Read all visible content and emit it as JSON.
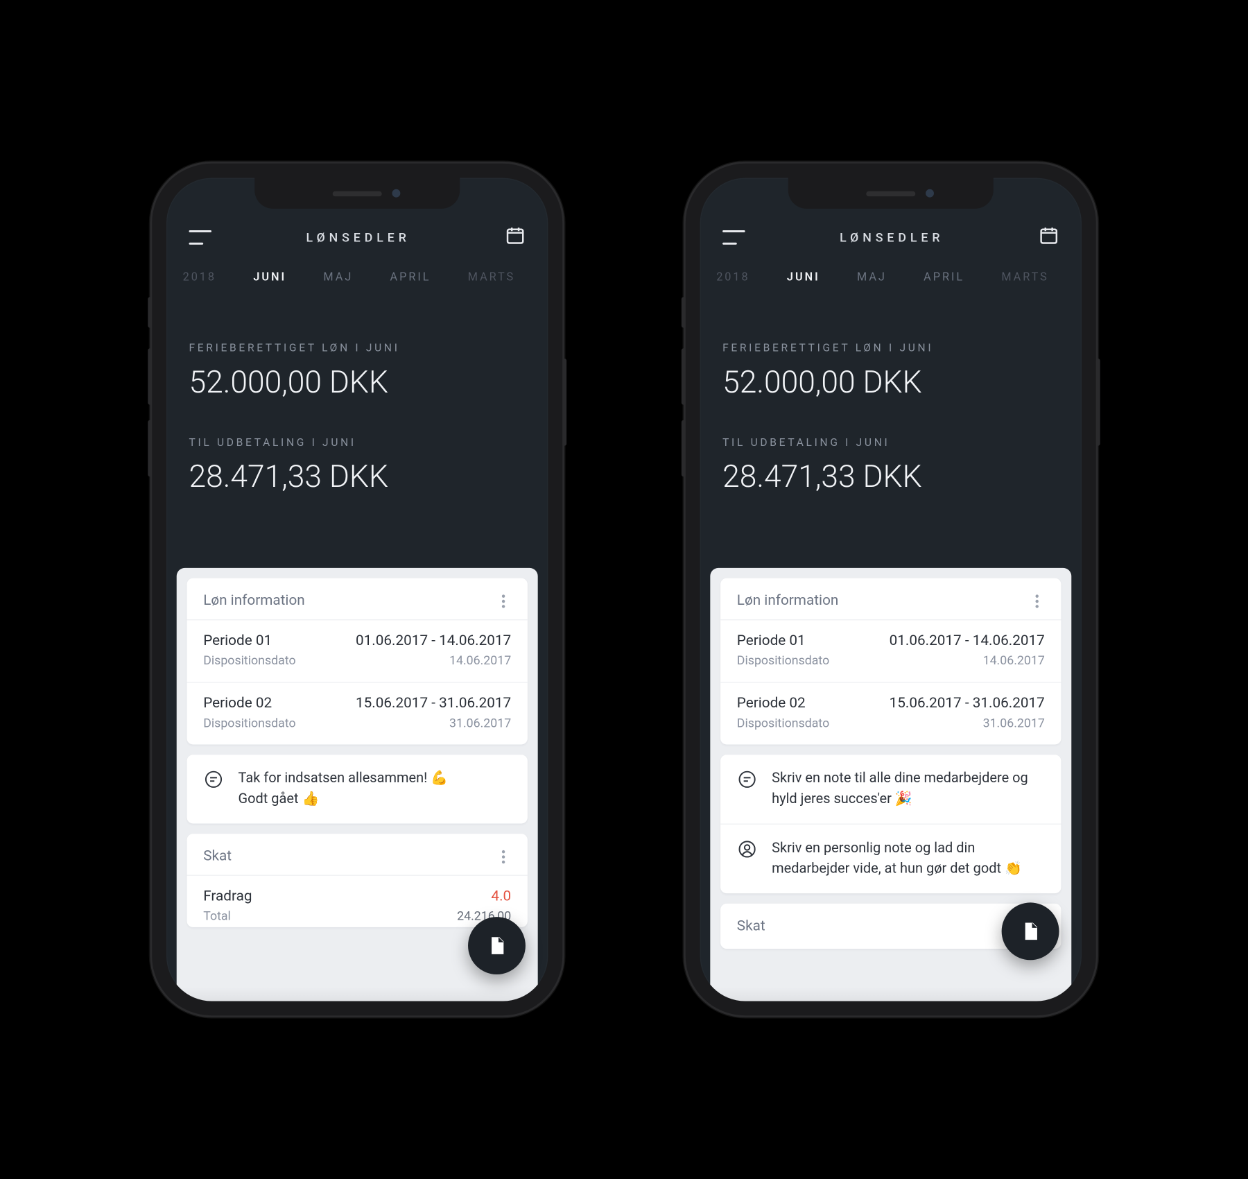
{
  "header": {
    "title": "LØNSEDLER"
  },
  "tabs": {
    "year": "2018",
    "items": [
      "JUNI",
      "MAJ",
      "APRIL",
      "MARTS"
    ],
    "active": "JUNI"
  },
  "hero": {
    "label1": "FERIEBERETTIGET LØN I JUNI",
    "value1": "52.000,00 DKK",
    "label2": "TIL UDBETALING I JUNI",
    "value2": "28.471,33 DKK"
  },
  "info_card": {
    "title": "Løn information",
    "periods": [
      {
        "name": "Periode 01",
        "range": "01.06.2017 - 14.06.2017",
        "dispo_label": "Dispositionsdato",
        "dispo_date": "14.06.2017"
      },
      {
        "name": "Periode 02",
        "range": "15.06.2017 - 31.06.2017",
        "dispo_label": "Dispositionsdato",
        "dispo_date": "31.06.2017"
      }
    ]
  },
  "notes_left": [
    {
      "icon": "chat-icon",
      "text": "Tak for indsatsen allesammen! 💪\nGodt gået 👍"
    }
  ],
  "notes_right": [
    {
      "icon": "chat-icon",
      "text": "Skriv en note til alle dine medarbejdere og hyld jeres succes'er 🎉"
    },
    {
      "icon": "person-icon",
      "text": "Skriv en personlig note og lad din medarbejder vide, at hun gør det godt 👏"
    }
  ],
  "skat": {
    "title": "Skat",
    "fradrag_label": "Fradrag",
    "fradrag_value": "4.0",
    "total_label": "Total",
    "total_value": "24.216,00"
  }
}
